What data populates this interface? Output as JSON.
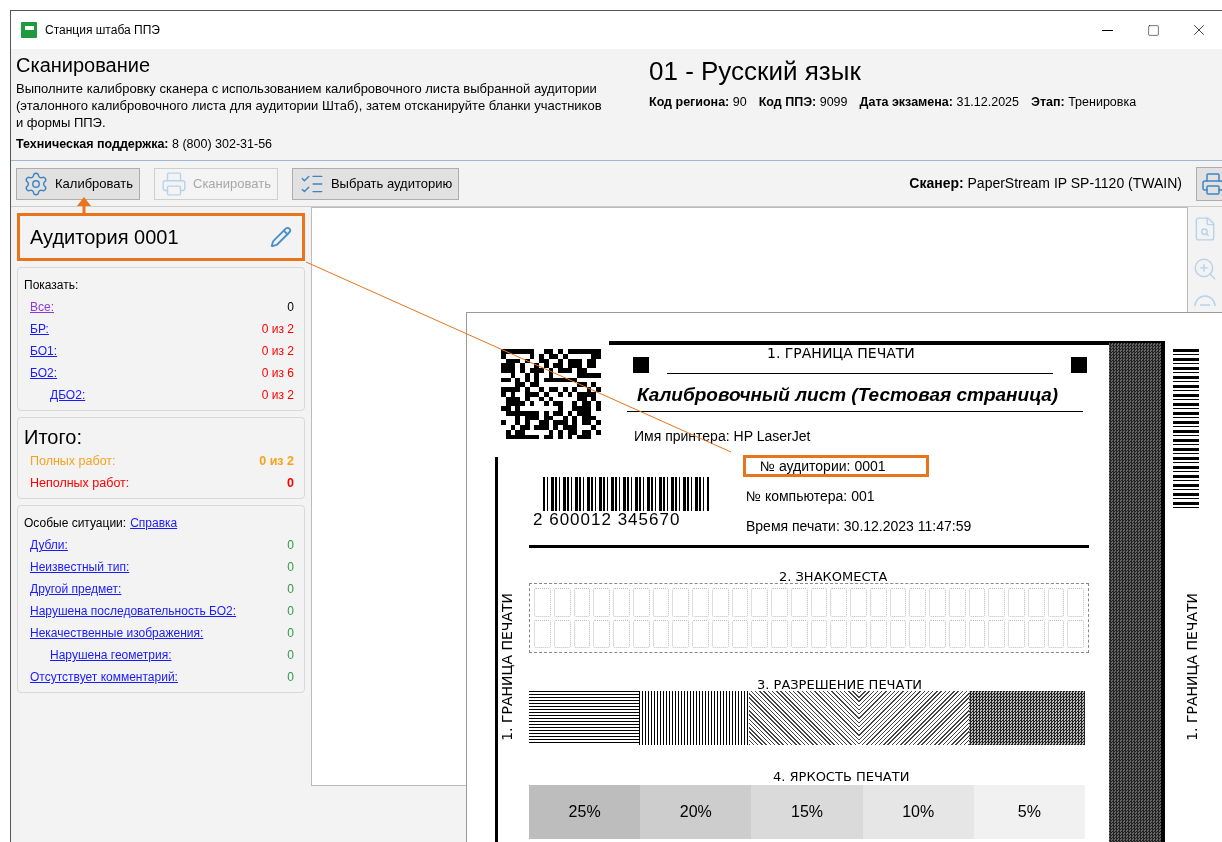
{
  "window": {
    "title": "Станция штаба ППЭ"
  },
  "header": {
    "title": "Сканирование",
    "instruction": "Выполните калибровку сканера с использованием калибровочного листа выбранной аудитории (эталонного калибровочного листа для аудитории Штаб), затем отсканируйте бланки участников и формы ППЭ.",
    "support_label": "Техническая поддержка:",
    "support_phone": "8 (800) 302-31-56",
    "subject": "01 - Русский язык",
    "meta": [
      {
        "label": "Код региона:",
        "value": "90"
      },
      {
        "label": "Код ППЭ:",
        "value": "9099"
      },
      {
        "label": "Дата экзамена:",
        "value": "31.12.2025"
      },
      {
        "label": "Этап:",
        "value": "Тренировка"
      }
    ]
  },
  "toolbar": {
    "buttons": [
      {
        "kind": "calibrate",
        "label": "Калибровать",
        "disabled": false
      },
      {
        "kind": "scan",
        "label": "Сканировать",
        "disabled": true
      },
      {
        "kind": "room",
        "label": "Выбрать аудиторию",
        "disabled": false
      }
    ],
    "scanner_label": "Сканер:",
    "scanner_value": "PaperStream IP SP-1120 (TWAIN)"
  },
  "room": {
    "title": "Аудитория 0001",
    "highlighted": true
  },
  "show": {
    "title": "Показать:",
    "items": [
      {
        "label": "Все:",
        "value": "0",
        "visited": true
      },
      {
        "label": "БР:",
        "value": "0 из 2",
        "visited": false,
        "color": "#ff0000"
      },
      {
        "label": "БО1:",
        "value": "0 из 2",
        "visited": false,
        "color": "#ff0000"
      },
      {
        "label": "БО2:",
        "value": "0 из 6",
        "visited": false,
        "color": "#ff0000",
        "children": [
          {
            "label": "ДБО2:",
            "value": "0 из 2",
            "visited": false,
            "color": "#ff0000"
          }
        ]
      }
    ]
  },
  "totals": {
    "title": "Итого:",
    "items": [
      {
        "label": "Полных работ:",
        "value": "0 из 2",
        "color": "#f7a21b"
      },
      {
        "label": "Неполных работ:",
        "value": "0",
        "color": "#ff0000"
      }
    ]
  },
  "special": {
    "title": "Особые ситуации:",
    "help_link": "Справка",
    "items": [
      {
        "label": "Дубли:",
        "value": "0"
      },
      {
        "label": "Неизвестный тип:",
        "value": "0"
      },
      {
        "label": "Другой предмет:",
        "value": "0"
      },
      {
        "label": "Нарушена последовательность БО2:",
        "value": "0"
      },
      {
        "label": "Некачественные изображения:",
        "value": "0",
        "children": [
          {
            "label": "Нарушена геометрия:",
            "value": "0"
          }
        ]
      },
      {
        "label": "Отсутствует комментарий:",
        "value": "0"
      }
    ]
  },
  "sheet": {
    "top_border": "1. ГРАНИЦА ПЕЧАТИ",
    "title": "Калибровочный лист (Тестовая страница)",
    "fields": [
      {
        "label": "Имя принтера:",
        "value": "HP LaserJet",
        "highlighted": false
      },
      {
        "label": "№ аудитории:",
        "value": "0001",
        "highlighted": true
      },
      {
        "label": "№ компьютера:",
        "value": "001",
        "highlighted": false
      },
      {
        "label": "Время печати:",
        "value": "30.12.2023 11:47:59",
        "highlighted": false
      }
    ],
    "barcode_number": "2 600012 345670",
    "cells_title": "2. ЗНАКОМЕСТА",
    "resolution_title": "3. РАЗРЕШЕНИЕ ПЕЧАТИ",
    "brightness_title": "4. ЯРКОСТЬ ПЕЧАТИ",
    "brightness": [
      "25%",
      "20%",
      "15%",
      "10%",
      "5%"
    ],
    "left_border": "1. ГРАНИЦА ПЕЧАТИ",
    "right_border": "1. ГРАНИЦА ПЕЧАТИ"
  }
}
